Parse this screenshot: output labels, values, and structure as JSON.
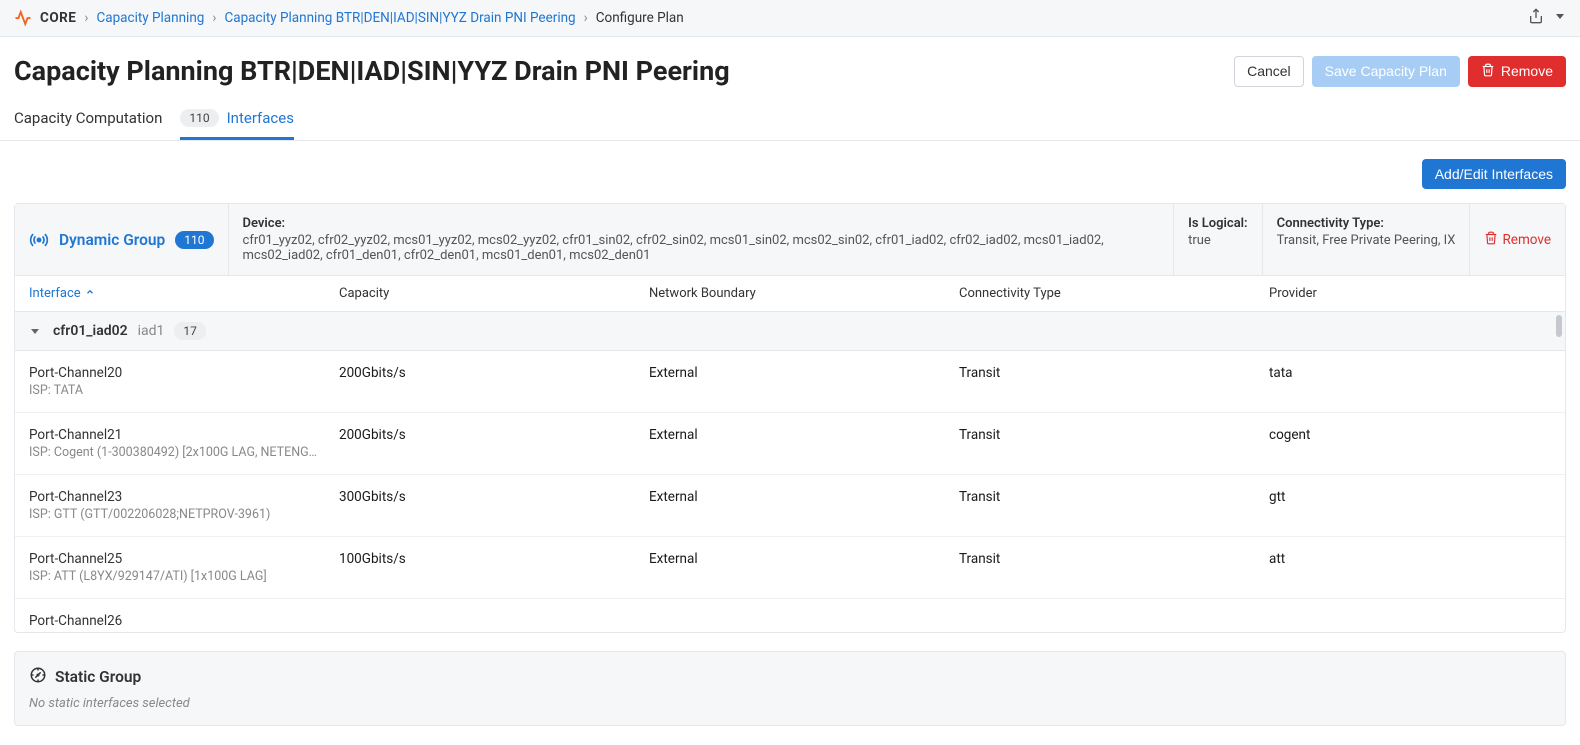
{
  "breadcrumb": {
    "brand": "CORE",
    "items": [
      {
        "label": "Capacity Planning",
        "link": true
      },
      {
        "label": "Capacity Planning BTR|DEN|IAD|SIN|YYZ Drain PNI Peering",
        "link": true
      },
      {
        "label": "Configure Plan",
        "link": false
      }
    ]
  },
  "page_title": "Capacity Planning BTR|DEN|IAD|SIN|YYZ Drain PNI Peering",
  "header_buttons": {
    "cancel": "Cancel",
    "save": "Save Capacity Plan",
    "remove": "Remove"
  },
  "tabs": {
    "computation": "Capacity Computation",
    "interfaces": {
      "label": "Interfaces",
      "badge": "110"
    }
  },
  "toolbar": {
    "add_edit": "Add/Edit Interfaces"
  },
  "dynamic_group": {
    "title": "Dynamic Group",
    "badge": "110",
    "device_label": "Device:",
    "device_value": "cfr01_yyz02, cfr02_yyz02, mcs01_yyz02, mcs02_yyz02, cfr01_sin02, cfr02_sin02, mcs01_sin02, mcs02_sin02, cfr01_iad02, cfr02_iad02, mcs01_iad02, mcs02_iad02, cfr01_den01, cfr02_den01, mcs01_den01, mcs02_den01",
    "logical_label": "Is Logical:",
    "logical_value": "true",
    "conn_label": "Connectivity Type:",
    "conn_value": "Transit, Free Private Peering, IX",
    "remove": "Remove"
  },
  "columns": {
    "interface": "Interface",
    "capacity": "Capacity",
    "boundary": "Network Boundary",
    "connectivity": "Connectivity Type",
    "provider": "Provider"
  },
  "group_row": {
    "name": "cfr01_iad02",
    "sub": "iad1",
    "count": "17"
  },
  "rows": [
    {
      "iface": "Port-Channel20",
      "desc": "ISP: TATA",
      "capacity": "200Gbits/s",
      "boundary": "External",
      "conn": "Transit",
      "provider": "tata"
    },
    {
      "iface": "Port-Channel21",
      "desc": "ISP: Cogent (1-300380492) [2x100G LAG, NETENG-...",
      "capacity": "200Gbits/s",
      "boundary": "External",
      "conn": "Transit",
      "provider": "cogent"
    },
    {
      "iface": "Port-Channel23",
      "desc": "ISP: GTT (GTT/002206028;NETPROV-3961)",
      "capacity": "300Gbits/s",
      "boundary": "External",
      "conn": "Transit",
      "provider": "gtt"
    },
    {
      "iface": "Port-Channel25",
      "desc": "ISP: ATT (L8YX/929147/ATI) [1x100G LAG]",
      "capacity": "100Gbits/s",
      "boundary": "External",
      "conn": "Transit",
      "provider": "att"
    },
    {
      "iface": "Port-Channel26",
      "desc": "",
      "capacity": "",
      "boundary": "",
      "conn": "",
      "provider": ""
    }
  ],
  "static_group": {
    "title": "Static Group",
    "empty": "No static interfaces selected"
  }
}
